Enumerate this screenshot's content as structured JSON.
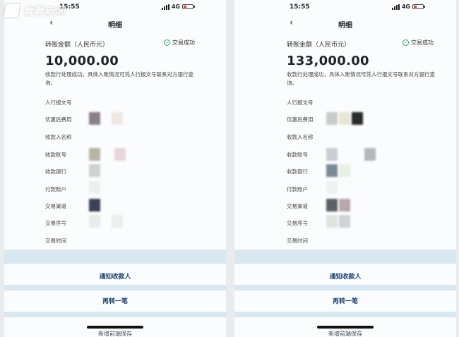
{
  "watermark": {
    "text": "看看新闻"
  },
  "left": {
    "status": {
      "time": "15:55",
      "network": "4G"
    },
    "nav": {
      "title": "明细"
    },
    "amount_label": "转账金额（人民币元）",
    "status_badge": "交易成功",
    "amount": "10,000.00",
    "note": "收款行处理成功，具体入账情况可凭人行报文号联系对方银行查询。",
    "fields": [
      "人行报文号",
      "优惠后费用",
      "收款人名称",
      "收款账号",
      "收款银行",
      "付款账户",
      "交易渠道",
      "交易序号",
      "交易时间"
    ],
    "actions": {
      "notify": "通知收款人",
      "again": "再转一笔",
      "cutoff": "新增前端保存"
    }
  },
  "right": {
    "status": {
      "time": "15:55",
      "network": "4G"
    },
    "nav": {
      "title": "明细"
    },
    "amount_label": "转账金额（人民币元）",
    "status_badge": "交易成功",
    "amount": "133,000.00",
    "note": "收款行处理成功，具体入账情况可凭人行报文号联系对方银行查询。",
    "fields": [
      "人行报文号",
      "优惠后费用",
      "收款人名称",
      "收款账号",
      "收款银行",
      "付款账户",
      "交易渠道",
      "交易序号",
      "交易时间"
    ],
    "actions": {
      "notify": "通知收款人",
      "again": "再转一笔",
      "cutoff": "新增前端保存"
    }
  },
  "colors": {
    "success": "#29a36b",
    "action_text": "#1f3f6e",
    "band": "#d8e7f0"
  }
}
